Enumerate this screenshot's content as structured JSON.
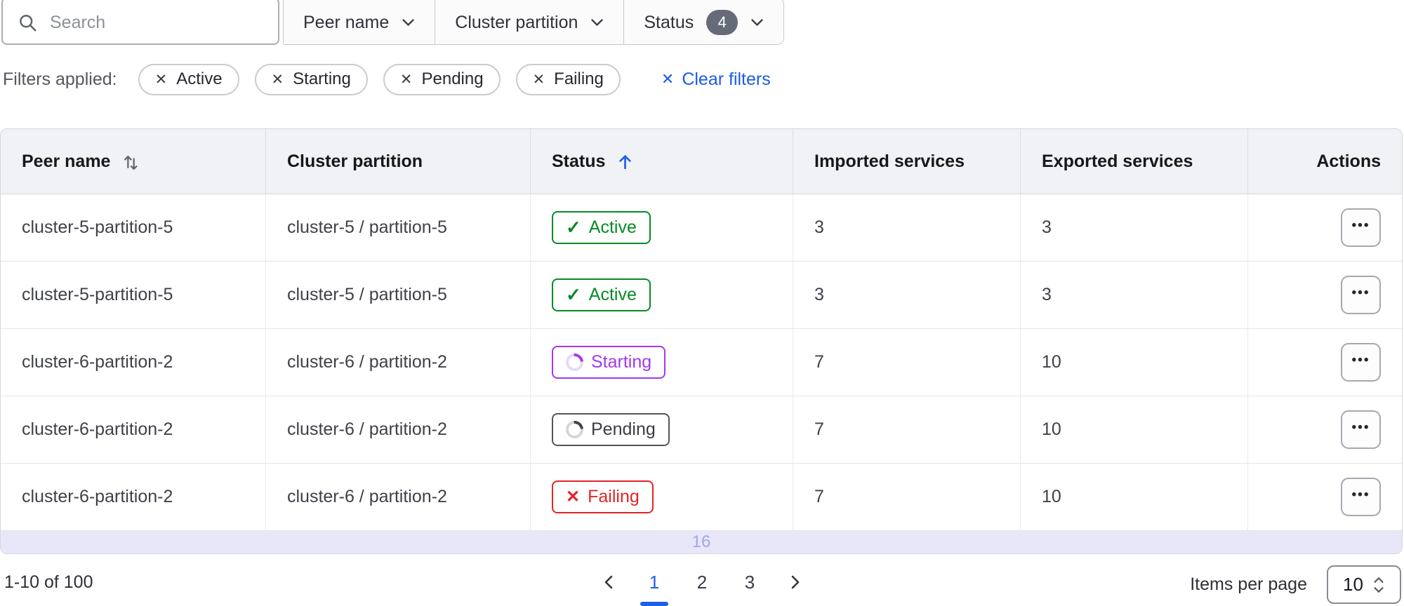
{
  "toolbar": {
    "search": {
      "placeholder": "Search"
    },
    "dropdowns": [
      {
        "label": "Peer name"
      },
      {
        "label": "Cluster partition"
      },
      {
        "label": "Status",
        "count": "4"
      }
    ]
  },
  "filters": {
    "label": "Filters applied:",
    "chips": [
      {
        "label": "Active"
      },
      {
        "label": "Starting"
      },
      {
        "label": "Pending"
      },
      {
        "label": "Failing"
      }
    ],
    "clear_label": "Clear filters"
  },
  "table": {
    "columns": [
      {
        "label": "Peer name",
        "sort": "sortable"
      },
      {
        "label": "Cluster partition"
      },
      {
        "label": "Status",
        "sort": "ascending"
      },
      {
        "label": "Imported services"
      },
      {
        "label": "Exported services"
      },
      {
        "label": "Actions"
      }
    ],
    "rows": [
      {
        "peer_name": "cluster-5-partition-5",
        "cluster_partition": "cluster-5 / partition-5",
        "status": "Active",
        "status_variant": "active",
        "imported": "3",
        "exported": "3"
      },
      {
        "peer_name": "cluster-5-partition-5",
        "cluster_partition": "cluster-5 / partition-5",
        "status": "Active",
        "status_variant": "active",
        "imported": "3",
        "exported": "3"
      },
      {
        "peer_name": "cluster-6-partition-2",
        "cluster_partition": "cluster-6 / partition-2",
        "status": "Starting",
        "status_variant": "starting",
        "imported": "7",
        "exported": "10"
      },
      {
        "peer_name": "cluster-6-partition-2",
        "cluster_partition": "cluster-6 / partition-2",
        "status": "Pending",
        "status_variant": "pending",
        "imported": "7",
        "exported": "10"
      },
      {
        "peer_name": "cluster-6-partition-2",
        "cluster_partition": "cluster-6 / partition-2",
        "status": "Failing",
        "status_variant": "failing",
        "imported": "7",
        "exported": "10"
      }
    ],
    "overflow_label": "16"
  },
  "pagination": {
    "range_label": "1-10 of 100",
    "pages": [
      "1",
      "2",
      "3"
    ],
    "current_page": "1",
    "items_per_page_label": "Items per page",
    "items_per_page_value": "10"
  },
  "icons": {
    "ellipsis": "•••",
    "remove": "✕"
  },
  "colors": {
    "accent_blue": "#1c5fe8",
    "success_green": "#068a26",
    "highlight_purple": "#a437ee",
    "neutral_dark": "#3b3d45",
    "critical_red": "#e32427",
    "overflow_lavender": "#e7e7f9",
    "header_bg": "#f1f2f5"
  }
}
